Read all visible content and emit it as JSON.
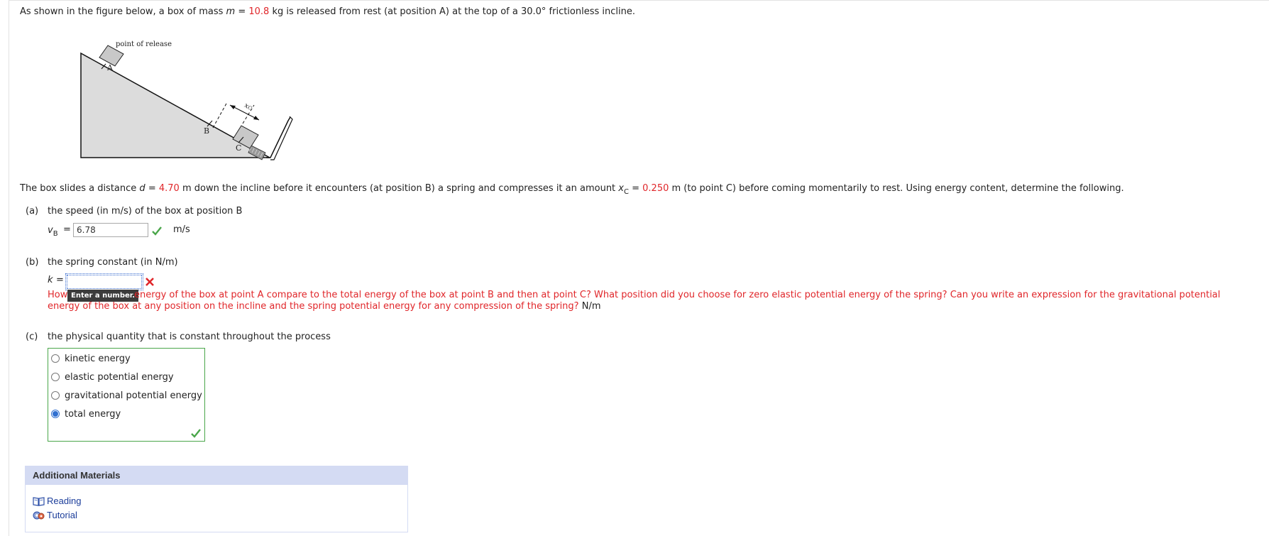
{
  "intro": {
    "prefix": "As shown in the figure below, a box of mass ",
    "mass_symbol": "m",
    "eq": " = ",
    "mass_value": "10.8",
    "suffix": " kg is released from rest (at position A) at the top of a 30.0° frictionless incline."
  },
  "figure": {
    "point_of_release_label": "point of release",
    "label_a": "A",
    "label_b": "B",
    "label_c": "C",
    "label_xc": "x",
    "label_xc_sub": "C"
  },
  "description": {
    "p1": "The box slides a distance ",
    "d_symbol": "d",
    "eq1": " = ",
    "d_value": "4.70",
    "p2": " m down the incline before it encounters (at position B) a spring and compresses it an amount ",
    "x_symbol": "x",
    "x_sub": "C",
    "eq2": " = ",
    "x_value": "0.250",
    "p3": " m (to point C) before coming momentarily to rest. Using energy content, determine the following."
  },
  "part_a": {
    "letter": "(a)",
    "prompt": "the speed (in m/s) of the box at position B",
    "var": "v",
    "var_sub": "B",
    "eq": "=",
    "value": "6.78",
    "unit": "m/s",
    "status_icon": "green-check-icon"
  },
  "part_b": {
    "letter": "(b)",
    "prompt": "the spring constant (in N/m)",
    "var": "k",
    "eq": "=",
    "value": "",
    "status_icon": "red-x-icon",
    "tooltip": "Enter a number.",
    "hint_line1_lead": "How",
    "hint_line1_rest": "energy of the box at point A compare to the total energy of the box at point B and then at point C? What position did you choose for zero elastic potential energy of the spring? Can you write an expression for the gravitational potential",
    "hint_line2": "energy of the box at any position on the incline and the spring potential energy for any compression of the spring?",
    "unit": "N/m"
  },
  "part_c": {
    "letter": "(c)",
    "prompt": "the physical quantity that is constant throughout the process",
    "options": [
      "kinetic energy",
      "elastic potential energy",
      "gravitational potential energy",
      "total energy"
    ],
    "selected": "total energy"
  },
  "additional_materials": {
    "title": "Additional Materials",
    "links": [
      "Reading",
      "Tutorial"
    ]
  },
  "colors": {
    "given_value": "#e0262a",
    "correct": "#4aa64a",
    "link": "#1b3d9a",
    "panel_header": "#d4dbf3"
  }
}
